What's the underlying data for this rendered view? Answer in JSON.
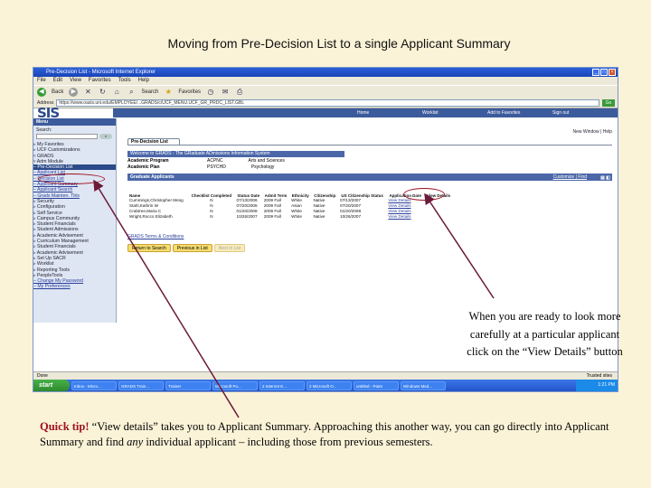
{
  "slide": {
    "title": "Moving from Pre-Decision List to a single Applicant Summary"
  },
  "browser": {
    "title": "Pre-Decision List - Microsoft Internet Explorer",
    "menu": [
      "File",
      "Edit",
      "View",
      "Favorites",
      "Tools",
      "Help"
    ],
    "toolbar": {
      "back": "Back",
      "search": "Search",
      "favorites": "Favorites"
    },
    "address_label": "Address",
    "url": "https://www.oasis.uni.edu/EMPLOYEE/...GRADS/c/UCF_MENU.UCF_GR_PRDC_LIST.GBL",
    "go": "Go",
    "status_left": "Done",
    "status_right": "Trusted sites"
  },
  "app": {
    "logo": "SIS",
    "topnav": [
      "Home",
      "Worklist",
      "Add to Favorites",
      "Sign out"
    ],
    "new_window": "New Window | Help",
    "menu": {
      "header": "Menu",
      "search_label": "Search:",
      "search_btn": "»",
      "items": [
        "▹ My Favorites",
        "▹ UCF Customizations",
        "▿ GRADS",
        "   ▿ Adm Module",
        "     – Pre-Decision List",
        "     – Applicant List",
        "     – Decision List",
        "     – Applicant Summary",
        "     – Applicant Search",
        "     – Grads Mainten. Tbls",
        "▹ Security",
        "▹ Configuration",
        "▹ Self Service",
        "▹ Campus Community",
        "▹ Student Financials",
        "▹ Student Admissions",
        "▹ Academic Advisement",
        "▹ Curriculum Management",
        "▹ Student Financials",
        "▹ Academic Advisement",
        "▹ Set Up SACR",
        "▹ Worklist",
        "▹ Reporting Tools",
        "▹ PeopleTools",
        "– Change My Password",
        "– My Preferences"
      ]
    },
    "page_tab": "Pre-Decision List",
    "welcome": "Welcome to GRADS - The GRaduate ADmissions Information System",
    "info": [
      {
        "k": "Academic Program",
        "v1": "ACPNC",
        "v2": "Arts and Sciences"
      },
      {
        "k": "Academic Plan",
        "v1": "PSYCHD",
        "v2": "Psychology"
      }
    ],
    "grid": {
      "title": "Graduate Applicants",
      "customize": "Customize | Find",
      "icons": "▤ ◧",
      "headers": [
        "Name",
        "Checklist Completed",
        "Status Date",
        "Admit Term",
        "Ethnicity",
        "Citizenship",
        "US Citizenship Status",
        "Application Date",
        "View Details"
      ],
      "rows": [
        [
          "Cummings,Christopher Meng",
          "N",
          "07/13/2006",
          "2009 Fall",
          "White",
          "Native",
          "07/13/2007",
          "View Details"
        ],
        [
          "Stahl,Kathrin W",
          "N",
          "07/20/2006",
          "2009 Fall",
          "Asian",
          "Native",
          "07/20/2007",
          "View Details"
        ],
        [
          "Crabtree,Maria C",
          "N",
          "01/20/2008",
          "2009 Fall",
          "White",
          "Native",
          "01/20/2008",
          "View Details"
        ],
        [
          "Wright,Rocco Elizabeth",
          "N",
          "10/26/2007",
          "2009 Fall",
          "White",
          "Native",
          "10/26/2007",
          "View Details"
        ]
      ]
    },
    "grads_link": "GRADS Terms & Conditions",
    "buttons": {
      "return": "Return to Search",
      "previous": "Previous in List",
      "next": "Next in List"
    }
  },
  "taskbar": {
    "start": "start",
    "tasks": [
      "Inbox - Micro...",
      "GRADS Train...",
      "Trainer",
      "Microsoft Po...",
      "2 Internet E...",
      "2 Microsoft O...",
      "untitled - Paint",
      "Windows Med..."
    ],
    "clock": "1:21 PM"
  },
  "callout": {
    "line1": "When you are ready to look more",
    "line2": "carefully at a particular applicant",
    "line3": "click on the “View Details” button"
  },
  "quick_tip": {
    "label": "Quick tip!",
    "text_a": "“View details” takes you to Applicant Summary.  Approaching this another way, you can go directly into Applicant Summary and find",
    "emph": "any",
    "text_b": "individual applicant – including those from previous semesters."
  },
  "colors": {
    "annotation": "#a01020",
    "background": "#fbf3d8",
    "sis_blue": "#3c5b9c"
  }
}
